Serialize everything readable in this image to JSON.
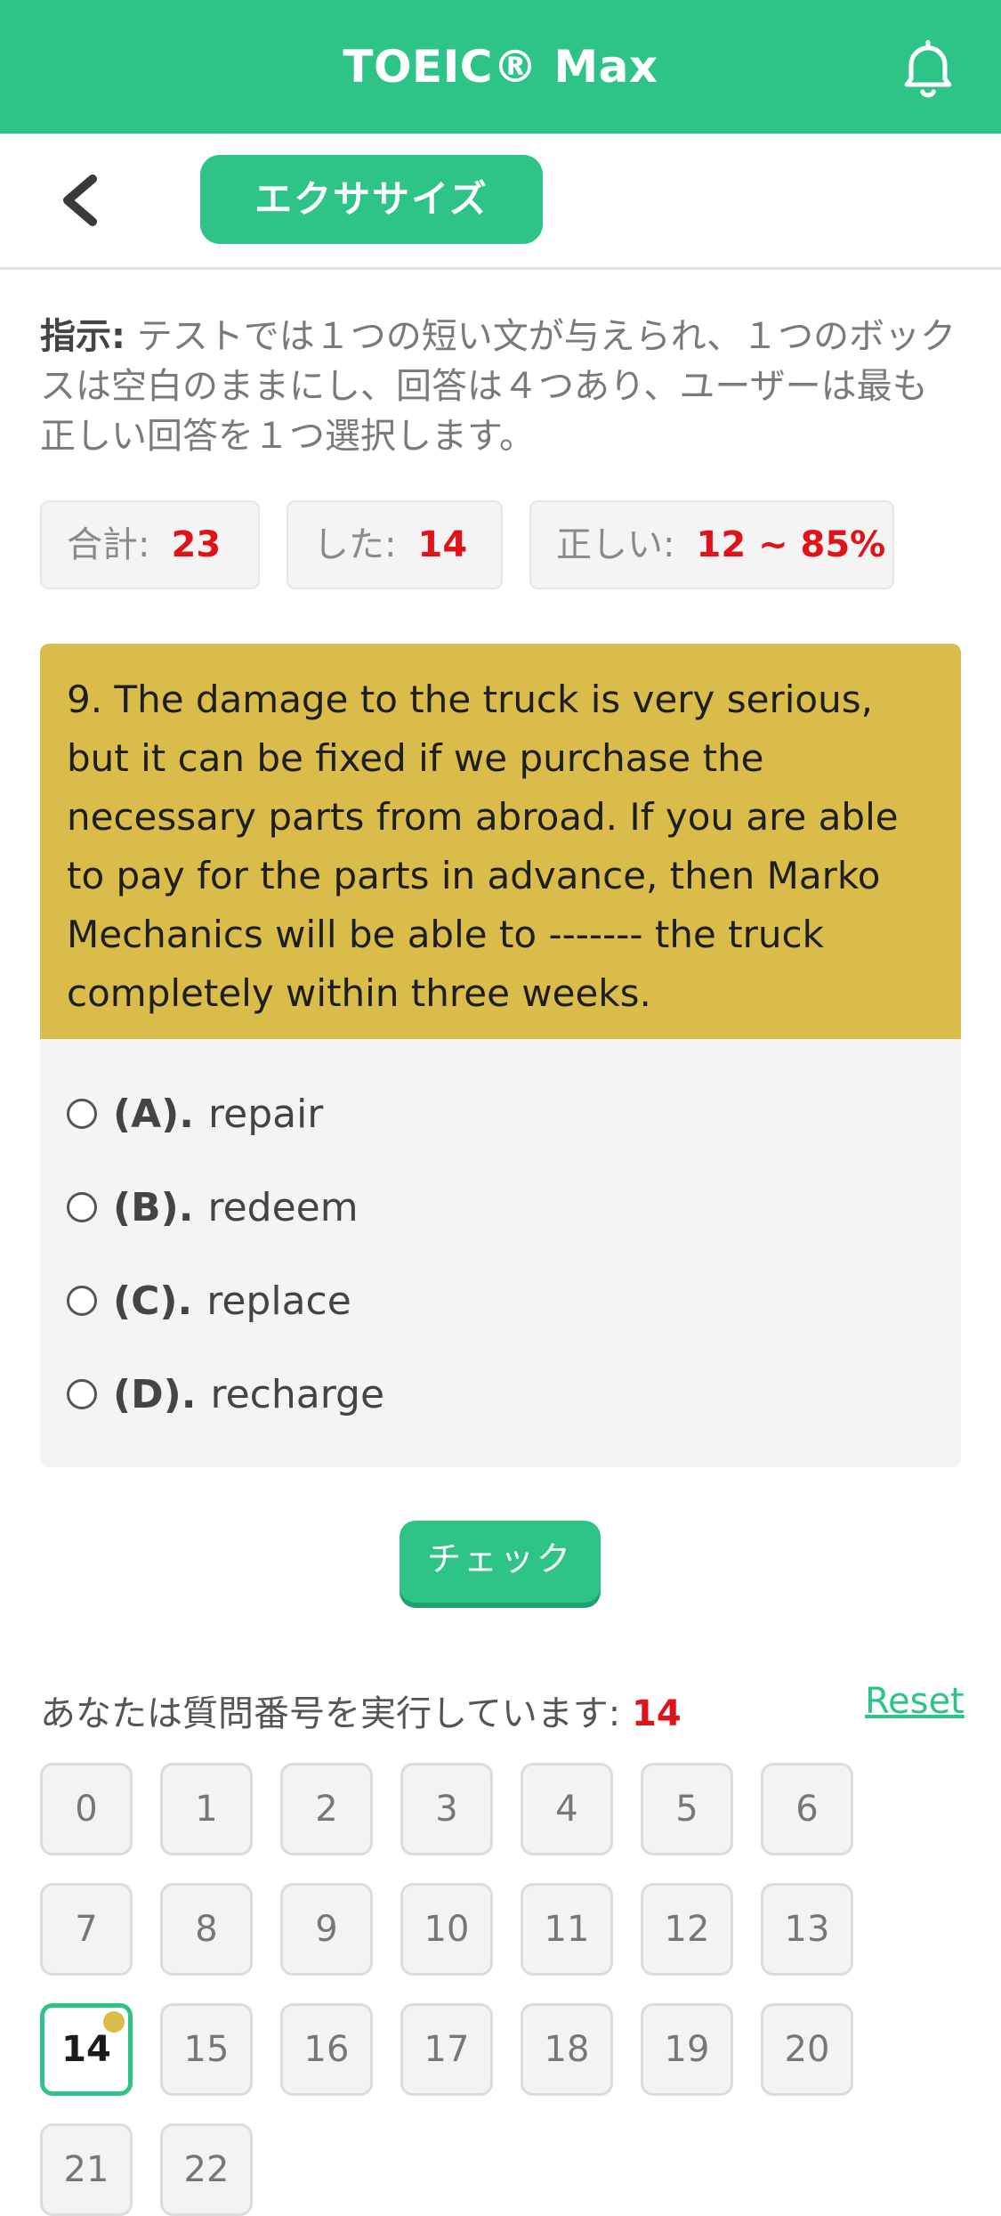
{
  "app": {
    "title": "TOEIC® Max"
  },
  "subbar": {
    "exercise_label": "エクササイズ"
  },
  "instructions": {
    "label": "指示:",
    "text": " テストでは１つの短い文が与えられ、１つのボックスは空白のままにし、回答は４つあり、ユーザーは最も正しい回答を１つ選択します。"
  },
  "stats": {
    "total_label": "合計:",
    "total_value": "23",
    "done_label": "した:",
    "done_value": "14",
    "correct_label": "正しい:",
    "correct_value": "12 ~ 85%"
  },
  "question": {
    "text": "9. The damage to the truck is very serious, but it can be fixed if we purchase the necessary parts from abroad. If you are able to pay for the parts in advance, then Marko Mechanics will be able to ------- the truck completely within three weeks.",
    "options": [
      {
        "letter": "(A).",
        "text": "repair"
      },
      {
        "letter": "(B).",
        "text": "redeem"
      },
      {
        "letter": "(C).",
        "text": "replace"
      },
      {
        "letter": "(D).",
        "text": "recharge"
      }
    ]
  },
  "check_label": "チェック",
  "progress": {
    "label": "あなたは質問番号を実行しています: ",
    "current": "14",
    "reset_label": "Reset"
  },
  "question_numbers": [
    "0",
    "1",
    "2",
    "3",
    "4",
    "5",
    "6",
    "7",
    "8",
    "9",
    "10",
    "11",
    "12",
    "13",
    "14",
    "15",
    "16",
    "17",
    "18",
    "19",
    "20",
    "21",
    "22"
  ],
  "colors": {
    "primary": "#2ec487",
    "question_bg": "#d9bc4a",
    "highlight": "#e0131b"
  },
  "icons": {
    "notification": "bell-icon",
    "back": "chevron-left-icon"
  }
}
